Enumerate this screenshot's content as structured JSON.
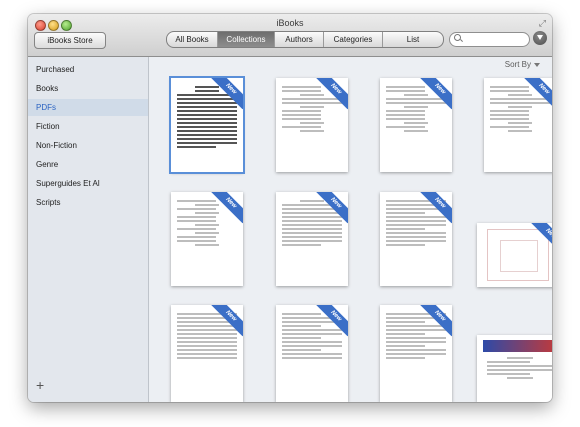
{
  "window": {
    "title": "iBooks"
  },
  "toolbar": {
    "store_button": "iBooks Store",
    "tabs": [
      {
        "label": "All Books",
        "active": false
      },
      {
        "label": "Collections",
        "active": true
      },
      {
        "label": "Authors",
        "active": false
      },
      {
        "label": "Categories",
        "active": false
      },
      {
        "label": "List",
        "active": false
      }
    ],
    "search_placeholder": ""
  },
  "sidebar": {
    "items": [
      {
        "label": "Purchased",
        "active": false
      },
      {
        "label": "Books",
        "active": false
      },
      {
        "label": "PDFs",
        "active": true
      },
      {
        "label": "Fiction",
        "active": false
      },
      {
        "label": "Non-Fiction",
        "active": false
      },
      {
        "label": "Genre",
        "active": false
      },
      {
        "label": "Superguides Et Al",
        "active": false
      },
      {
        "label": "Scripts",
        "active": false
      }
    ],
    "add_button": "+"
  },
  "content": {
    "sort_label": "Sort By",
    "badge_text": "New",
    "books": [
      {
        "kind": "doc",
        "new": true,
        "selected": true
      },
      {
        "kind": "script",
        "new": true
      },
      {
        "kind": "script",
        "new": true
      },
      {
        "kind": "script",
        "new": true
      },
      {
        "kind": "script",
        "new": true
      },
      {
        "kind": "doc",
        "new": true
      },
      {
        "kind": "doc",
        "new": true
      },
      {
        "kind": "blueprint",
        "new": true
      },
      {
        "kind": "doc",
        "new": true
      },
      {
        "kind": "doc",
        "new": true
      },
      {
        "kind": "doc",
        "new": true
      },
      {
        "kind": "certificate",
        "new": false
      }
    ]
  },
  "colors": {
    "accent": "#3b6fc7",
    "sidebar_bg": "#e3e7ed",
    "selected_sidebar": "#d0dbe8"
  }
}
